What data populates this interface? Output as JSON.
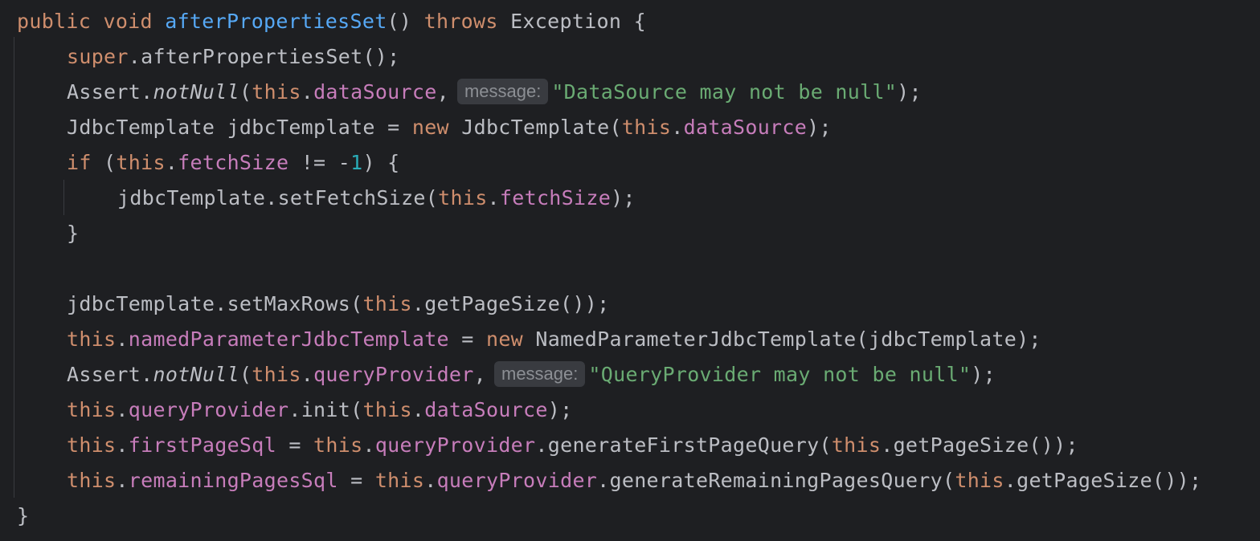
{
  "editor": {
    "lines": {
      "l1": {
        "public": "public",
        "void": "void",
        "method": "afterPropertiesSet",
        "parens": "()",
        "throws": "throws",
        "exc": " Exception {"
      },
      "l2": {
        "super": "super",
        "rest": ".afterPropertiesSet();"
      },
      "l3": {
        "assert": "Assert.",
        "notNull": "notNull",
        "open": "(",
        "this": "this",
        "dot": ".",
        "field": "dataSource",
        "comma": ",",
        "hint": "message:",
        "str": "\"DataSource may not be null\"",
        "close": ");"
      },
      "l4": {
        "decl": "JdbcTemplate jdbcTemplate = ",
        "new": "new",
        "ctor": " JdbcTemplate(",
        "this": "this",
        "dot": ".",
        "field": "dataSource",
        "close": ");"
      },
      "l5": {
        "if": "if",
        "open": " (",
        "this": "this",
        "dot": ".",
        "field": "fetchSize",
        "op": " != -",
        "num": "1",
        "close": ") {"
      },
      "l6": {
        "call": "jdbcTemplate.setFetchSize(",
        "this": "this",
        "dot": ".",
        "field": "fetchSize",
        "close": ");"
      },
      "l7": {
        "brace": "}"
      },
      "l9": {
        "call": "jdbcTemplate.setMaxRows(",
        "this": "this",
        "rest": ".getPageSize());"
      },
      "l10": {
        "this": "this",
        "dot": ".",
        "field": "namedParameterJdbcTemplate",
        "eq": " = ",
        "new": "new",
        "rest": " NamedParameterJdbcTemplate(jdbcTemplate);"
      },
      "l11": {
        "assert": "Assert.",
        "notNull": "notNull",
        "open": "(",
        "this": "this",
        "dot": ".",
        "field": "queryProvider",
        "comma": ",",
        "hint": "message:",
        "str": "\"QueryProvider may not be null\"",
        "close": ");"
      },
      "l12": {
        "this": "this",
        "dot": ".",
        "field": "queryProvider",
        "call": ".init(",
        "this2": "this",
        "dot2": ".",
        "field2": "dataSource",
        "close": ");"
      },
      "l13": {
        "this": "this",
        "dot": ".",
        "field": "firstPageSql",
        "eq": " = ",
        "this2": "this",
        "dot2": ".",
        "field2": "queryProvider",
        "call": ".generateFirstPageQuery(",
        "this3": "this",
        "rest": ".getPageSize());"
      },
      "l14": {
        "this": "this",
        "dot": ".",
        "field": "remainingPagesSql",
        "eq": " = ",
        "this2": "this",
        "dot2": ".",
        "field2": "queryProvider",
        "call": ".generateRemainingPagesQuery(",
        "this3": "this",
        "rest": ".getPageSize());"
      },
      "l15": {
        "brace": "}"
      }
    },
    "colors": {
      "background": "#1e1f22",
      "keyword": "#cf8e6d",
      "method_declaration": "#56a8f5",
      "field": "#c77dbb",
      "string": "#6aab73",
      "number": "#2aacb8",
      "plain": "#bcbec4",
      "inlay_hint_bg": "#393b40",
      "inlay_hint_fg": "#8c8f94"
    }
  }
}
